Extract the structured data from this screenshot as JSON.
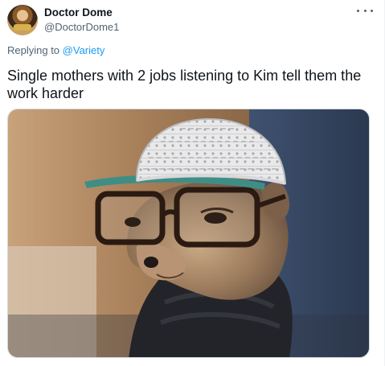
{
  "tweet": {
    "author_name": "Doctor Dome",
    "author_handle": "@DoctorDome1",
    "replying_prefix": "Replying to",
    "replying_to": "@Variety",
    "text": "Single mothers with 2 jobs listening to Kim tell them the work harder",
    "media_icon": "dog-with-glasses-and-kufi-image",
    "more_icon": "more-options-icon"
  },
  "colors": {
    "link": "#1d9bf0",
    "secondary_text": "#536471",
    "primary_text": "#0f1419",
    "border": "#cfd9de"
  }
}
